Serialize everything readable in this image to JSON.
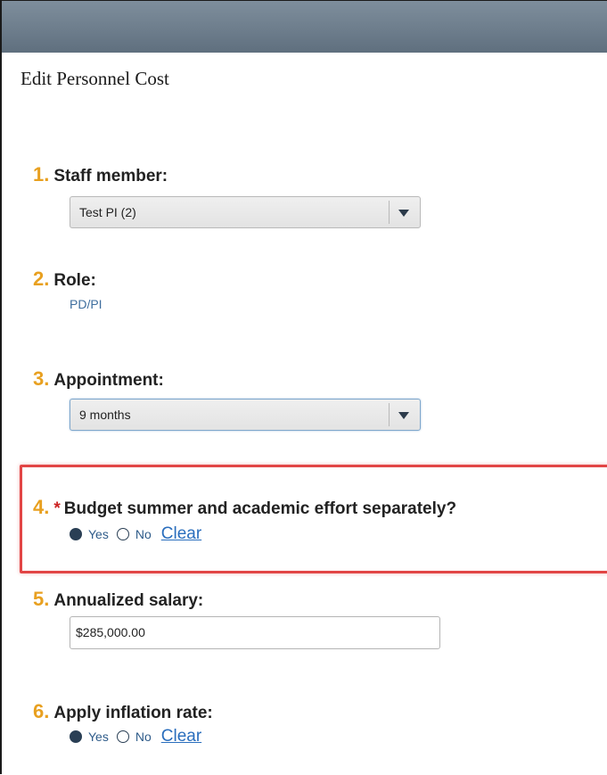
{
  "page": {
    "title": "Edit Personnel Cost"
  },
  "questions": [
    {
      "number": "1.",
      "label": "Staff member:",
      "type": "select",
      "value": "Test PI (2)"
    },
    {
      "number": "2.",
      "label": "Role:",
      "type": "static",
      "value": "PD/PI"
    },
    {
      "number": "3.",
      "label": "Appointment:",
      "type": "select",
      "value": "9 months"
    },
    {
      "number": "4.",
      "required_marker": "*",
      "label": "Budget summer and academic effort separately?",
      "type": "radio",
      "options": [
        "Yes",
        "No"
      ],
      "selected": "Yes",
      "clear_label": "Clear"
    },
    {
      "number": "5.",
      "label": "Annualized salary:",
      "type": "text",
      "value": "$285,000.00"
    },
    {
      "number": "6.",
      "label": "Apply inflation rate:",
      "type": "radio",
      "options": [
        "Yes",
        "No"
      ],
      "selected": "Yes",
      "clear_label": "Clear"
    }
  ],
  "colors": {
    "question_number": "#e8a020",
    "required": "#cc2222",
    "highlight_border": "#e24545",
    "link": "#2a6ebd",
    "header_bar": "#6c7c8b"
  },
  "icons": {
    "dropdown": "triangle-down-icon",
    "radio_checked": "radio-filled-icon",
    "radio_unchecked": "radio-empty-icon"
  }
}
